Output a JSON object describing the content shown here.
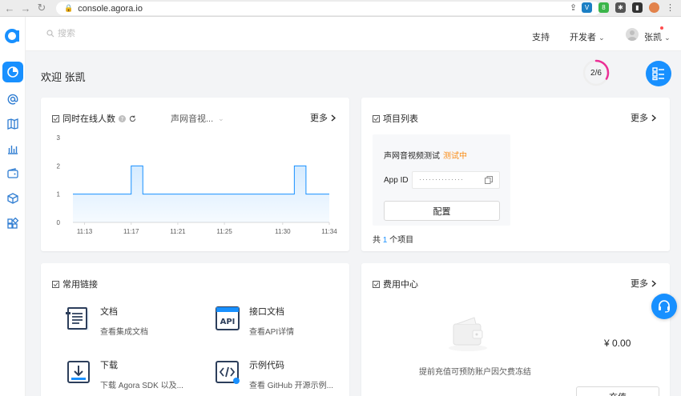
{
  "browser": {
    "url": "console.agora.io"
  },
  "sidebar": {
    "items": [
      {
        "icon": "dashboard-icon"
      },
      {
        "icon": "at-icon"
      },
      {
        "icon": "map-icon"
      },
      {
        "icon": "bar-chart-icon"
      },
      {
        "icon": "wallet-icon"
      },
      {
        "icon": "cube-icon"
      },
      {
        "icon": "apps-icon"
      }
    ]
  },
  "header": {
    "search_placeholder": "搜索",
    "support": "支持",
    "developer": "开发者",
    "username": "张凯"
  },
  "welcome": {
    "text": "欢迎 张凯",
    "progress_label": "2/6",
    "progress": 0.333
  },
  "online_card": {
    "title": "同时在线人数",
    "dropdown": "声网音视...",
    "more": "更多"
  },
  "chart_data": {
    "type": "area",
    "x": [
      "11:12",
      "11:13",
      "11:14",
      "11:15",
      "11:16",
      "11:17",
      "11:17",
      "11:18",
      "11:18",
      "11:19",
      "11:20",
      "11:21",
      "11:22",
      "11:23",
      "11:25",
      "11:26",
      "11:27",
      "11:28",
      "11:29",
      "11:30",
      "11:31",
      "11:31",
      "11:32",
      "11:32",
      "11:33",
      "11:34"
    ],
    "values": [
      1,
      1,
      1,
      1,
      1,
      1,
      2,
      2,
      1,
      1,
      1,
      1,
      1,
      1,
      1,
      1,
      1,
      1,
      1,
      1,
      1,
      2,
      2,
      1,
      1,
      1
    ],
    "x_ticks": [
      "11:13",
      "11:17",
      "11:21",
      "11:25",
      "11:30",
      "11:34"
    ],
    "y_ticks": [
      "3",
      "2",
      "1",
      "0"
    ],
    "ylim": [
      0,
      3
    ],
    "color": "#1890ff"
  },
  "project_card": {
    "title": "项目列表",
    "more": "更多",
    "project_name": "声网音视频测试",
    "project_status": "测试中",
    "appid_label": "App ID",
    "appid_masked": "··············",
    "config_button": "配置",
    "count_prefix": "共",
    "count_num": "1",
    "count_suffix": "个项目"
  },
  "links_card": {
    "title": "常用链接",
    "items": [
      {
        "title": "文档",
        "sub": "查看集成文档"
      },
      {
        "title": "接口文档",
        "sub": "查看API详情"
      },
      {
        "title": "下载",
        "sub": "下载 Agora SDK 以及..."
      },
      {
        "title": "示例代码",
        "sub": "查看 GitHub 开源示例..."
      }
    ]
  },
  "billing_card": {
    "title": "费用中心",
    "more": "更多",
    "balance": "¥ 0.00",
    "note": "提前充值可预防账户因欠费冻结",
    "recharge": "充值"
  },
  "colors": {
    "primary": "#1890ff",
    "warning": "#fa8c16",
    "ring": "#eb2f96"
  }
}
